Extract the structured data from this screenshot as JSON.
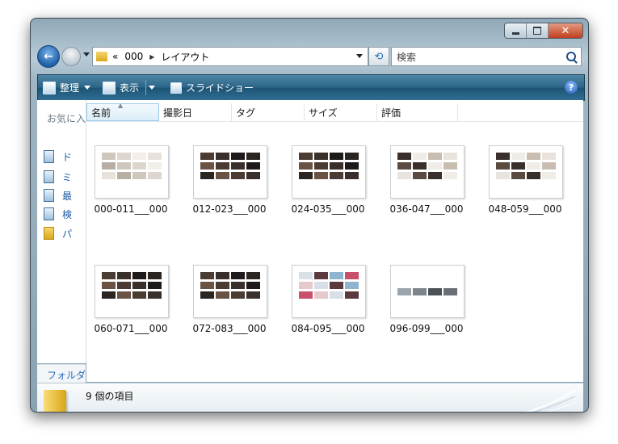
{
  "window": {
    "minimize": "minimize",
    "maximize": "maximize",
    "close": "✕"
  },
  "nav": {
    "breadcrumb": [
      "«",
      "000",
      "レイアウト"
    ],
    "search_placeholder": "検索"
  },
  "toolbar": {
    "organize": "整理",
    "view": "表示",
    "slideshow": "スライドショー",
    "help": "?"
  },
  "sidebar": {
    "title": "お気に入",
    "items": [
      "ド",
      "ミ",
      "最",
      "検",
      "パ"
    ],
    "folders": "フォルダ"
  },
  "columns": [
    "名前",
    "撮影日",
    "タグ",
    "サイズ",
    "評価"
  ],
  "files": [
    {
      "name": "000-011___000",
      "tone": "light"
    },
    {
      "name": "012-023___000",
      "tone": "dark"
    },
    {
      "name": "024-035___000",
      "tone": "dark"
    },
    {
      "name": "036-047___000",
      "tone": "mixed"
    },
    {
      "name": "048-059___000",
      "tone": "mixed"
    },
    {
      "name": "060-071___000",
      "tone": "dark"
    },
    {
      "name": "072-083___000",
      "tone": "dark"
    },
    {
      "name": "084-095___000",
      "tone": "color"
    },
    {
      "name": "096-099___000",
      "tone": "sparse"
    }
  ],
  "status": {
    "item_count": "9 個の項目"
  },
  "colors": {
    "toolbar": "#2a6487",
    "link": "#1e5aa0",
    "selected_col": "#dbeef9"
  }
}
